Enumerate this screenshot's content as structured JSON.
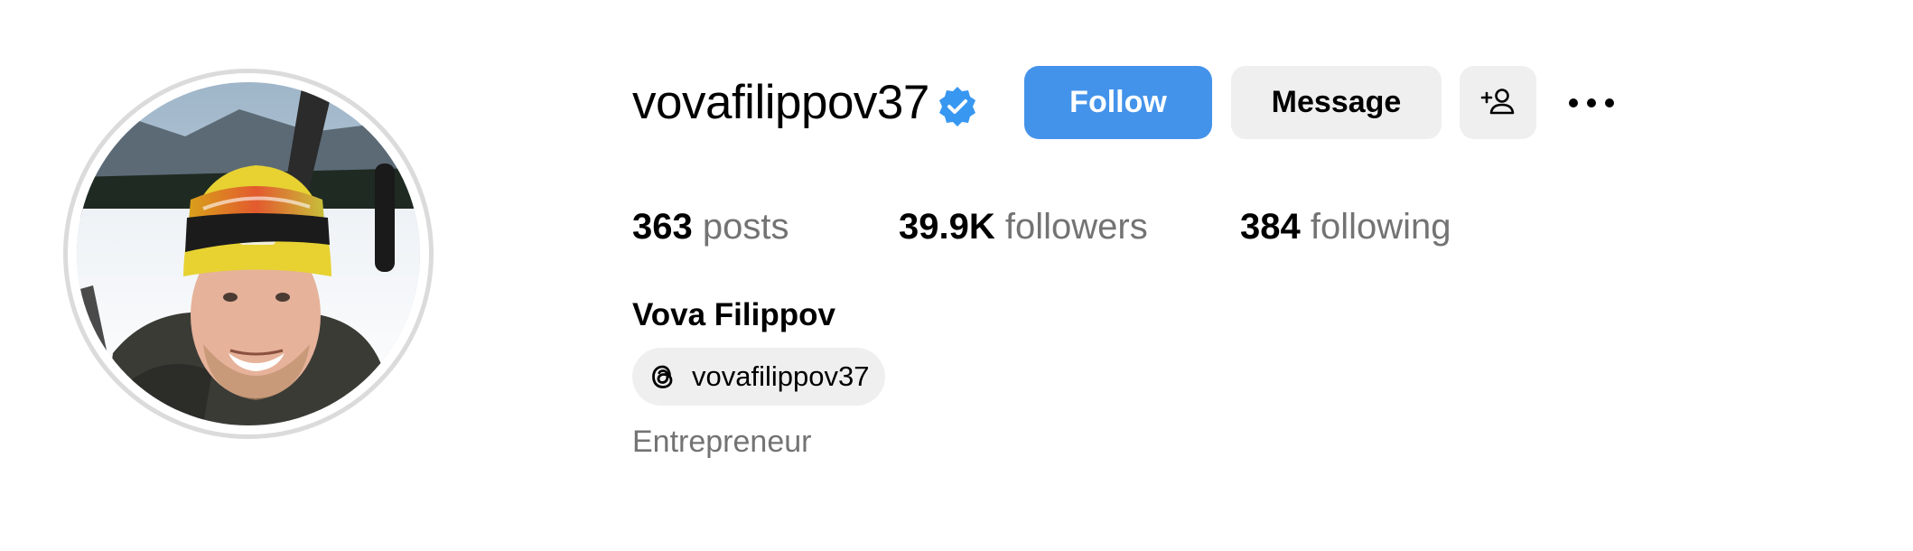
{
  "profile": {
    "username": "vovafilippov37",
    "verified": true,
    "full_name": "Vova Filippov",
    "category": "Entrepreneur",
    "threads_handle": "vovafilippov37",
    "avatar": "profile-photo"
  },
  "actions": {
    "follow_label": "Follow",
    "message_label": "Message",
    "suggest_icon": "add-person-icon",
    "more_icon": "more-options-icon"
  },
  "stats": {
    "posts_count": "363",
    "posts_label": "posts",
    "followers_count": "39.9K",
    "followers_label": "followers",
    "following_count": "384",
    "following_label": "following"
  },
  "colors": {
    "accent": "#4493ea",
    "verified_badge": "#3897f0",
    "secondary_text": "#737373",
    "button_gray": "#efefef"
  }
}
